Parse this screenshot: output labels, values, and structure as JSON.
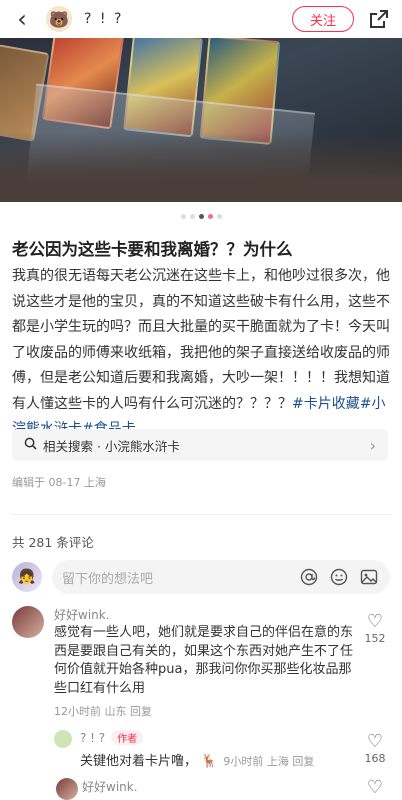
{
  "header": {
    "author_name": "? ! ?",
    "follow_label": "关注"
  },
  "post": {
    "title": "老公因为这些卡要和我离婚？？为什么",
    "body_main": "我真的很无语每天老公沉迷在这些卡上，和他吵过很多次，他说这些才是他的宝贝，真的不知道这些破卡有什么用，这些不都是小学生玩的吗？而且大批量的买干脆面就为了卡！今天叫了收废品的师傅来收纸箱，我把他的架子直接送给收废品的师傅，但是老公知道后要和我离婚，大吵一架！！！！我想知道有人懂这些卡的人吗有什么可沉迷的？？？？",
    "tags": [
      "#卡片收藏",
      "#小浣熊水浒卡",
      "#食品卡"
    ],
    "related_search": "相关搜索 · 小浣熊水浒卡",
    "edit_info": "编辑于 08-17 上海"
  },
  "comments_section": {
    "count_label": "共 281 条评论",
    "input_placeholder": "留下你的想法吧",
    "icons": [
      "at-icon",
      "emoji-icon",
      "image-icon"
    ]
  },
  "comments": [
    {
      "name": "好好wink.",
      "text": "感觉有一些人吧，她们就是要求自己的伴侣在意的东西是要跟自己有关的，如果这个东西对她产生不了任何价值就开始各种pua，那我问你你买那些化妆品那些口红有什么用",
      "meta": "12小时前  山东  回复",
      "likes": "152"
    },
    {
      "name": "好好wink.",
      "text": "",
      "meta": "",
      "likes": ""
    }
  ],
  "reply": {
    "name": "? ! ?",
    "badge": "作者",
    "text": "关键他对着卡片噜，",
    "meta": "9小时前  上海  回复",
    "likes": "168"
  }
}
